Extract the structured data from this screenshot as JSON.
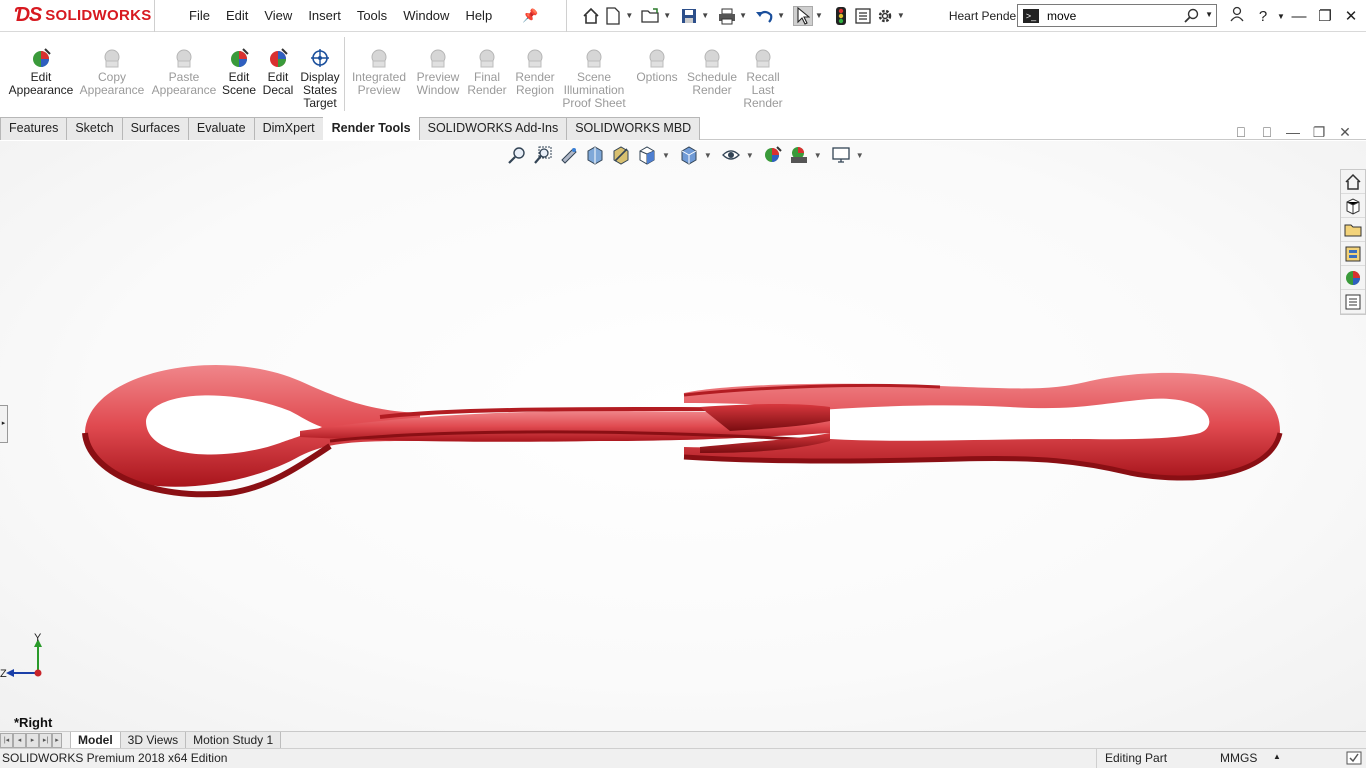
{
  "app": {
    "brand": "SOLIDWORKS",
    "document_title": "Heart Pendent *",
    "menu": [
      "File",
      "Edit",
      "View",
      "Insert",
      "Tools",
      "Window",
      "Help"
    ],
    "accent_color": "#d71920"
  },
  "search": {
    "value": "move"
  },
  "commands": [
    {
      "label": "Edit\nAppearance",
      "icon": "edit-appearance-icon",
      "enabled": true
    },
    {
      "label": "Copy\nAppearance",
      "icon": "copy-appearance-icon",
      "enabled": false
    },
    {
      "label": "Paste\nAppearance",
      "icon": "paste-appearance-icon",
      "enabled": false
    },
    {
      "label": "Edit\nScene",
      "icon": "edit-scene-icon",
      "enabled": true
    },
    {
      "label": "Edit\nDecal",
      "icon": "edit-decal-icon",
      "enabled": true
    },
    {
      "label": "Display\nStates\nTarget",
      "icon": "display-states-target-icon",
      "enabled": true
    },
    {
      "label": "Integrated\nPreview",
      "icon": "integrated-preview-icon",
      "enabled": false
    },
    {
      "label": "Preview\nWindow",
      "icon": "preview-window-icon",
      "enabled": false
    },
    {
      "label": "Final\nRender",
      "icon": "final-render-icon",
      "enabled": false
    },
    {
      "label": "Render\nRegion",
      "icon": "render-region-icon",
      "enabled": false
    },
    {
      "label": "Scene\nIllumination\nProof Sheet",
      "icon": "scene-illumination-icon",
      "enabled": false
    },
    {
      "label": "Options",
      "icon": "options-icon",
      "enabled": false
    },
    {
      "label": "Schedule\nRender",
      "icon": "schedule-render-icon",
      "enabled": false
    },
    {
      "label": "Recall\nLast\nRender",
      "icon": "recall-last-render-icon",
      "enabled": false
    }
  ],
  "tabs": [
    "Features",
    "Sketch",
    "Surfaces",
    "Evaluate",
    "DimXpert",
    "Render Tools",
    "SOLIDWORKS Add-Ins",
    "SOLIDWORKS MBD"
  ],
  "active_tab": "Render Tools",
  "viewport": {
    "view_name": "*Right",
    "axis_y": "Y",
    "axis_z": "Z",
    "model_color": "#d62f35"
  },
  "model_tabs": [
    "Model",
    "3D Views",
    "Motion Study 1"
  ],
  "active_model_tab": "Model",
  "status": {
    "edition": "SOLIDWORKS Premium 2018 x64 Edition",
    "mode": "Editing Part",
    "units": "MMGS"
  }
}
